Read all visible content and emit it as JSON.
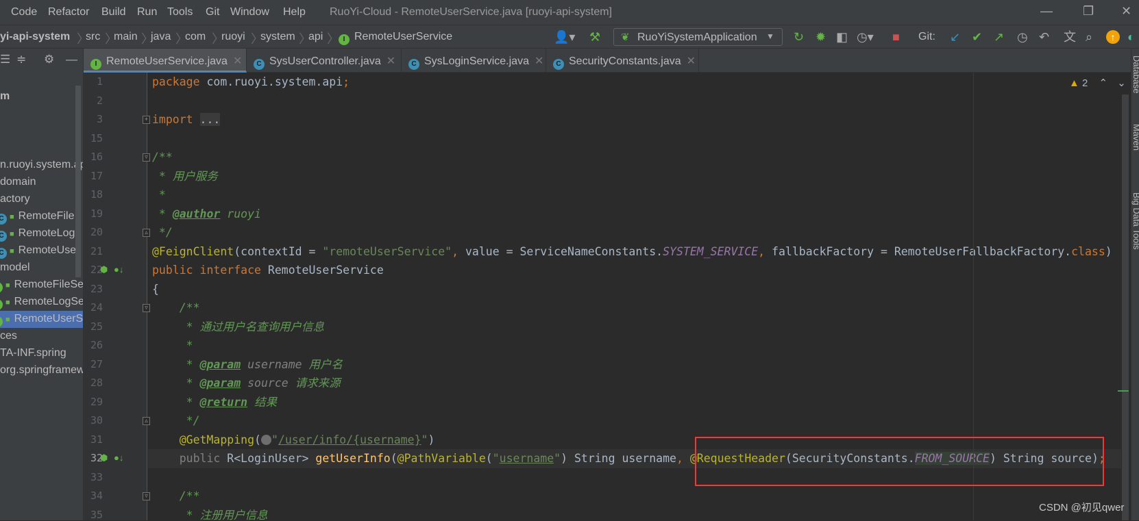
{
  "menu": {
    "items": [
      "Code",
      "Refactor",
      "Build",
      "Run",
      "Tools",
      "Git",
      "Window",
      "Help"
    ],
    "title": "RuoYi-Cloud - RemoteUserService.java [ruoyi-api-system]"
  },
  "breadcrumb": [
    "yi-api-system",
    "src",
    "main",
    "java",
    "com",
    "ruoyi",
    "system",
    "api",
    "RemoteUserService"
  ],
  "toolbar": {
    "run_config": "RuoYiSystemApplication",
    "git_label": "Git:"
  },
  "tabs": [
    {
      "label": "RemoteUserService.java",
      "type": "I",
      "active": true
    },
    {
      "label": "SysUserController.java",
      "type": "C"
    },
    {
      "label": "SysLoginService.java",
      "type": "C"
    },
    {
      "label": "SecurityConstants.java",
      "type": "C"
    }
  ],
  "project_tree": [
    {
      "label": "m",
      "bold": true,
      "row": 4
    },
    {
      "label": "n.ruoyi.system.ap",
      "row": 8
    },
    {
      "label": "domain",
      "row": 9
    },
    {
      "label": "actory",
      "row": 10
    },
    {
      "label": "RemoteFileI",
      "icon": "C",
      "row": 11
    },
    {
      "label": "RemoteLog",
      "icon": "C",
      "row": 12
    },
    {
      "label": "RemoteUse",
      "icon": "C",
      "row": 13
    },
    {
      "label": "model",
      "row": 14
    },
    {
      "label": "RemoteFileSer",
      "icon": "I",
      "row": 15
    },
    {
      "label": "RemoteLogSer",
      "icon": "I",
      "row": 16
    },
    {
      "label": "RemoteUserSe",
      "icon": "I",
      "row": 17,
      "selected": true
    },
    {
      "label": "ces",
      "row": 18
    },
    {
      "label": "TA-INF.spring",
      "row": 19
    },
    {
      "label": "org.springframew",
      "row": 20
    }
  ],
  "inspections": {
    "warnings": "2"
  },
  "right_tools": [
    "Database",
    "Maven",
    "Big Data Tools"
  ],
  "code": [
    {
      "n": "1",
      "t": [
        [
          "package",
          "kw"
        ],
        [
          " com.ruoyi.system.api",
          ""
        ],
        [
          ";",
          "kw"
        ]
      ]
    },
    {
      "n": "2",
      "t": []
    },
    {
      "n": "3",
      "fold": "+",
      "t": [
        [
          "import",
          "kw"
        ],
        [
          " ",
          ""
        ],
        [
          "...",
          "fold-dots"
        ]
      ]
    },
    {
      "n": "15",
      "t": []
    },
    {
      "n": "16",
      "fold": "-",
      "t": [
        [
          "/**",
          "cm"
        ]
      ]
    },
    {
      "n": "17",
      "t": [
        [
          " * 用户服务",
          "cm"
        ]
      ]
    },
    {
      "n": "18",
      "t": [
        [
          " *",
          "cm"
        ]
      ]
    },
    {
      "n": "19",
      "t": [
        [
          " * ",
          "cm"
        ],
        [
          "@author",
          "tag"
        ],
        [
          " ruoyi",
          "cm"
        ]
      ]
    },
    {
      "n": "20",
      "fold": "e",
      "t": [
        [
          " */",
          "cm"
        ]
      ]
    },
    {
      "n": "21",
      "t": [
        [
          "@FeignClient",
          "an"
        ],
        [
          "(contextId = ",
          ""
        ],
        [
          "\"remoteUserService\"",
          "str"
        ],
        [
          ", ",
          "kw"
        ],
        [
          "value = ServiceNameConstants.",
          ""
        ],
        [
          "SYSTEM_SERVICE",
          "cst"
        ],
        [
          ", ",
          "kw"
        ],
        [
          "fallbackFactory = RemoteUserFallbackFactory.",
          ""
        ],
        [
          "class",
          "kw"
        ],
        [
          ")",
          ""
        ]
      ]
    },
    {
      "n": "22",
      "icons": true,
      "t": [
        [
          "public interface",
          "kw"
        ],
        [
          " RemoteUserService",
          ""
        ]
      ]
    },
    {
      "n": "23",
      "t": [
        [
          "{",
          ""
        ]
      ]
    },
    {
      "n": "24",
      "fold": "-",
      "t": [
        [
          "    /**",
          "cm"
        ]
      ]
    },
    {
      "n": "25",
      "t": [
        [
          "     * 通过用户名查询用户信息",
          "cm"
        ]
      ]
    },
    {
      "n": "26",
      "t": [
        [
          "     *",
          "cm"
        ]
      ]
    },
    {
      "n": "27",
      "t": [
        [
          "     * ",
          "cm"
        ],
        [
          "@param",
          "tag"
        ],
        [
          " username",
          "pn"
        ],
        [
          " 用户名",
          "cm"
        ]
      ]
    },
    {
      "n": "28",
      "t": [
        [
          "     * ",
          "cm"
        ],
        [
          "@param",
          "tag"
        ],
        [
          " source",
          "pn"
        ],
        [
          " 请求来源",
          "cm"
        ]
      ]
    },
    {
      "n": "29",
      "t": [
        [
          "     * ",
          "cm"
        ],
        [
          "@return",
          "tag"
        ],
        [
          " 结果",
          "cm"
        ]
      ]
    },
    {
      "n": "30",
      "fold": "e",
      "t": [
        [
          "     */",
          "cm"
        ]
      ]
    },
    {
      "n": "31",
      "t": [
        [
          "    @GetMapping",
          "an"
        ],
        [
          "(",
          ""
        ],
        [
          "URL",
          "urlicon"
        ],
        [
          "\"",
          "str"
        ],
        [
          "/user/info/{username}",
          "ustr"
        ],
        [
          "\"",
          "str"
        ],
        [
          ")",
          ""
        ]
      ]
    },
    {
      "n": "32",
      "icons": true,
      "current": true,
      "t": [
        [
          "    public",
          "dim"
        ],
        [
          " R<LoginUser> ",
          ""
        ],
        [
          "getUserInfo",
          "fn"
        ],
        [
          "(",
          ""
        ],
        [
          "@PathVariable",
          "an"
        ],
        [
          "(",
          ""
        ],
        [
          "\"",
          "str"
        ],
        [
          "username",
          "ustr"
        ],
        [
          "\"",
          "str"
        ],
        [
          ") String username",
          ""
        ],
        [
          ", ",
          "kw"
        ],
        [
          "@RequestHeader",
          "an"
        ],
        [
          "(SecurityConstants.",
          ""
        ],
        [
          "FROM_SOURCE",
          "cst hl"
        ],
        [
          ") String source)",
          ""
        ],
        [
          ";",
          "kw"
        ]
      ]
    },
    {
      "n": "33",
      "t": []
    },
    {
      "n": "34",
      "fold": "-",
      "t": [
        [
          "    /**",
          "cm"
        ]
      ]
    },
    {
      "n": "35",
      "t": [
        [
          "     * 注册用户信息",
          "cm"
        ]
      ]
    }
  ],
  "watermark": "CSDN @初见qwer",
  "colors": {
    "background": "#2b2b2b",
    "panel": "#3c3f41",
    "keyword": "#cc7832",
    "string": "#6a8759",
    "comment": "#629755",
    "annotation": "#bbb529",
    "constant": "#9876aa",
    "highlight_box": "#ff3333"
  }
}
